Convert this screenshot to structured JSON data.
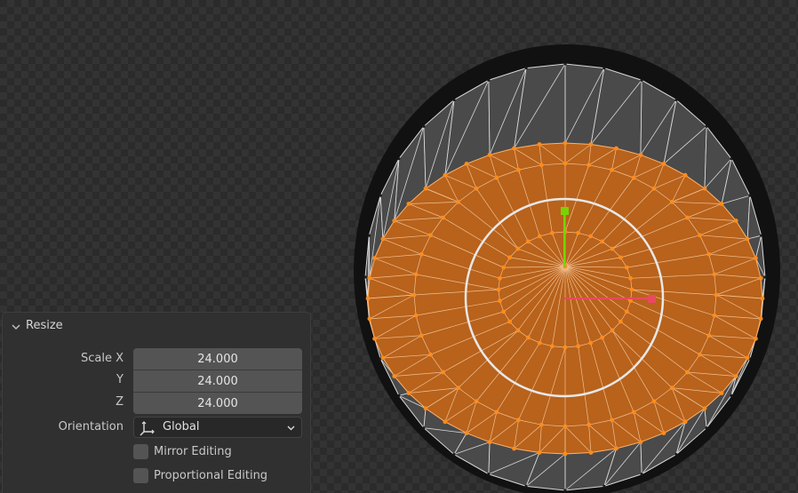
{
  "panel": {
    "title": "Resize",
    "scale_x": {
      "label": "Scale X",
      "value": "24.000"
    },
    "scale_y": {
      "label": "Y",
      "value": "24.000"
    },
    "scale_z": {
      "label": "Z",
      "value": "24.000"
    },
    "orientation": {
      "label": "Orientation",
      "value": "Global"
    },
    "mirror_editing": {
      "label": "Mirror Editing",
      "checked": false
    },
    "proportional_editing": {
      "label": "Proportional Editing",
      "checked": false
    }
  },
  "colors": {
    "viewport_bg": "#2b2b2b",
    "panel_bg": "#303030",
    "field_bg": "#545454",
    "selected_face": "#b8621c",
    "selected_vertex": "#ff8c1a",
    "unselected_face": "#4a4a4a",
    "gizmo_x": "#e84a5f",
    "gizmo_y": "#7ad300",
    "scale_circle": "#e8e8e8"
  },
  "icons": {
    "collapse": "chevron-down-icon",
    "orientation": "orientation-axes-icon",
    "dropdown": "chevron-down-icon"
  }
}
